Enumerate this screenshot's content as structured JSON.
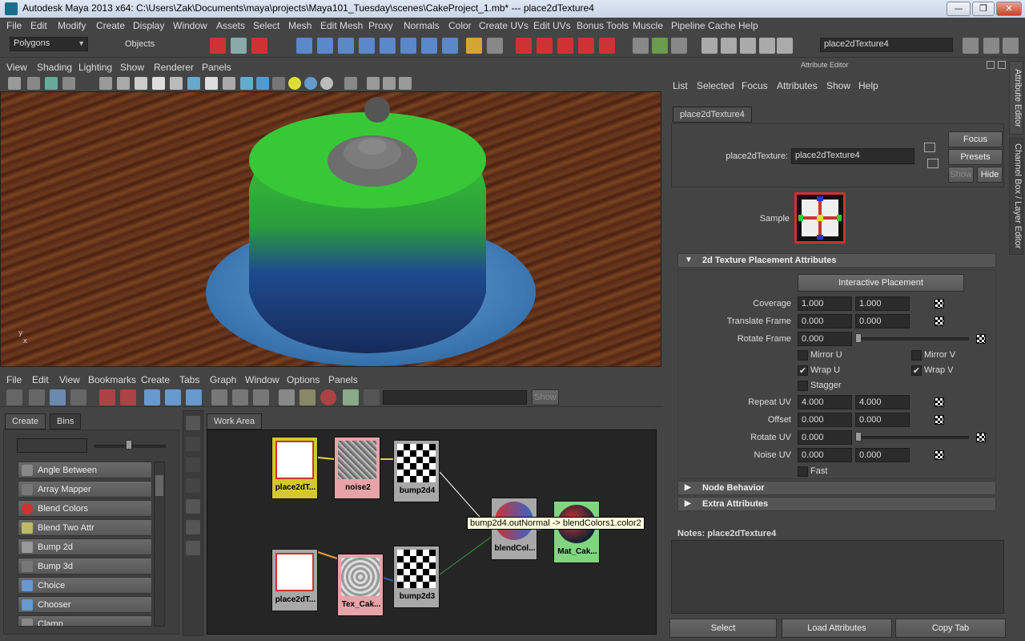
{
  "window": {
    "title": "Autodesk Maya 2013 x64: C:\\Users\\Zak\\Documents\\maya\\projects\\Maya101_Tuesday\\scenes\\CakeProject_1.mb*   ---   place2dTexture4",
    "controls": [
      "—",
      "❐",
      "✕"
    ]
  },
  "main_menu": [
    "File",
    "Edit",
    "Modify",
    "Create",
    "Display",
    "Window",
    "Assets",
    "Select",
    "Mesh",
    "Edit Mesh",
    "Proxy",
    "Normals",
    "Color",
    "Create UVs",
    "Edit UVs",
    "Bonus Tools",
    "Muscle",
    "Pipeline Cache",
    "Help"
  ],
  "status_line": {
    "menu_set": "Polygons",
    "selection_mode": "Objects",
    "name_field": "place2dTexture4"
  },
  "viewport": {
    "menu": [
      "View",
      "Shading",
      "Lighting",
      "Show",
      "Renderer",
      "Panels"
    ],
    "colors": {
      "cake_top": "#2fae2b",
      "cake_bottom": "#23356e",
      "plate": "#4a8cc8",
      "table": "#6b3a1e"
    }
  },
  "hypershade": {
    "menu": [
      "File",
      "Edit",
      "View",
      "Bookmarks",
      "Create",
      "Tabs",
      "Graph",
      "Window",
      "Options",
      "Panels"
    ],
    "show_button": "Show",
    "left_tabs": [
      "Create",
      "Bins"
    ],
    "create_list": [
      "Angle Between",
      "Array Mapper",
      "Blend Colors",
      "Blend Two Attr",
      "Bump 2d",
      "Bump 3d",
      "Choice",
      "Chooser",
      "Clamp"
    ],
    "work_area_tab": "Work Area",
    "nodes": [
      {
        "name": "place2dT...",
        "color": "#d4c82a"
      },
      {
        "name": "noise2",
        "color": "#e8a3a8"
      },
      {
        "name": "bump2d4",
        "color": "#a8a8a8"
      },
      {
        "name": "place2dT...",
        "color": "#a8a8a8"
      },
      {
        "name": "Tex_Cak...",
        "color": "#e8a3a8"
      },
      {
        "name": "bump2d3",
        "color": "#a8a8a8"
      },
      {
        "name": "blendCol...",
        "color": "#a8a8a8"
      },
      {
        "name": "Mat_Cak...",
        "color": "#7fd67f"
      }
    ],
    "tooltip": "bump2d4.outNormal -> blendColors1.color2"
  },
  "attribute_editor": {
    "header": "Attribute Editor",
    "menu": [
      "List",
      "Selected",
      "Focus",
      "Attributes",
      "Show",
      "Help"
    ],
    "node_tab": "place2dTexture4",
    "node_type_label": "place2dTexture:",
    "node_name": "place2dTexture4",
    "buttons": {
      "focus": "Focus",
      "presets": "Presets",
      "show": "Show",
      "hide": "Hide"
    },
    "sample_label": "Sample",
    "section_placement": "2d Texture Placement Attributes",
    "interactive_placement": "Interactive Placement",
    "coverage": {
      "label": "Coverage",
      "u": "1.000",
      "v": "1.000"
    },
    "translate_frame": {
      "label": "Translate Frame",
      "u": "0.000",
      "v": "0.000"
    },
    "rotate_frame": {
      "label": "Rotate Frame",
      "value": "0.000"
    },
    "mirror_u": {
      "label": "Mirror U",
      "checked": ""
    },
    "mirror_v": {
      "label": "Mirror V",
      "checked": ""
    },
    "wrap_u": {
      "label": "Wrap U",
      "checked": "✔"
    },
    "wrap_v": {
      "label": "Wrap V",
      "checked": "✔"
    },
    "stagger": {
      "label": "Stagger",
      "checked": ""
    },
    "repeat_uv": {
      "label": "Repeat UV",
      "u": "4.000",
      "v": "4.000"
    },
    "offset": {
      "label": "Offset",
      "u": "0.000",
      "v": "0.000"
    },
    "rotate_uv": {
      "label": "Rotate UV",
      "value": "0.000"
    },
    "noise_uv": {
      "label": "Noise UV",
      "u": "0.000",
      "v": "0.000"
    },
    "fast": {
      "label": "Fast",
      "checked": ""
    },
    "section_node_behavior": "Node Behavior",
    "section_extra": "Extra Attributes",
    "notes_label": "Notes:  place2dTexture4",
    "bottom_buttons": [
      "Select",
      "Load Attributes",
      "Copy Tab"
    ]
  },
  "side_tabs": [
    "Attribute Editor",
    "Channel Box / Layer Editor"
  ]
}
